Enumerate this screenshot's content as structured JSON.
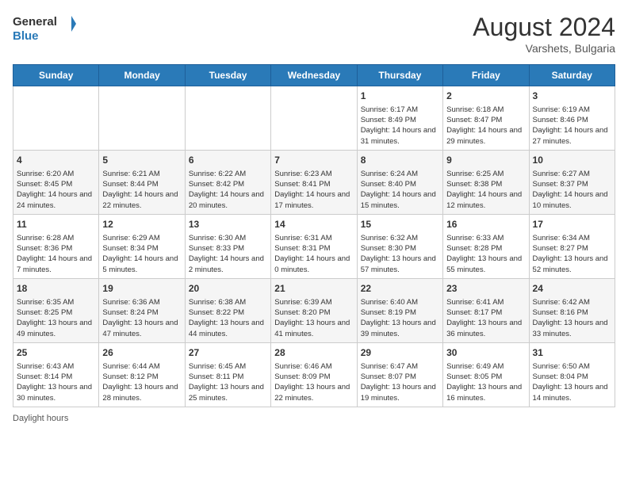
{
  "header": {
    "logo_general": "General",
    "logo_blue": "Blue",
    "month_year": "August 2024",
    "location": "Varshets, Bulgaria"
  },
  "days_of_week": [
    "Sunday",
    "Monday",
    "Tuesday",
    "Wednesday",
    "Thursday",
    "Friday",
    "Saturday"
  ],
  "weeks": [
    [
      {
        "day": "",
        "content": ""
      },
      {
        "day": "",
        "content": ""
      },
      {
        "day": "",
        "content": ""
      },
      {
        "day": "",
        "content": ""
      },
      {
        "day": "1",
        "content": "Sunrise: 6:17 AM\nSunset: 8:49 PM\nDaylight: 14 hours and 31 minutes."
      },
      {
        "day": "2",
        "content": "Sunrise: 6:18 AM\nSunset: 8:47 PM\nDaylight: 14 hours and 29 minutes."
      },
      {
        "day": "3",
        "content": "Sunrise: 6:19 AM\nSunset: 8:46 PM\nDaylight: 14 hours and 27 minutes."
      }
    ],
    [
      {
        "day": "4",
        "content": "Sunrise: 6:20 AM\nSunset: 8:45 PM\nDaylight: 14 hours and 24 minutes."
      },
      {
        "day": "5",
        "content": "Sunrise: 6:21 AM\nSunset: 8:44 PM\nDaylight: 14 hours and 22 minutes."
      },
      {
        "day": "6",
        "content": "Sunrise: 6:22 AM\nSunset: 8:42 PM\nDaylight: 14 hours and 20 minutes."
      },
      {
        "day": "7",
        "content": "Sunrise: 6:23 AM\nSunset: 8:41 PM\nDaylight: 14 hours and 17 minutes."
      },
      {
        "day": "8",
        "content": "Sunrise: 6:24 AM\nSunset: 8:40 PM\nDaylight: 14 hours and 15 minutes."
      },
      {
        "day": "9",
        "content": "Sunrise: 6:25 AM\nSunset: 8:38 PM\nDaylight: 14 hours and 12 minutes."
      },
      {
        "day": "10",
        "content": "Sunrise: 6:27 AM\nSunset: 8:37 PM\nDaylight: 14 hours and 10 minutes."
      }
    ],
    [
      {
        "day": "11",
        "content": "Sunrise: 6:28 AM\nSunset: 8:36 PM\nDaylight: 14 hours and 7 minutes."
      },
      {
        "day": "12",
        "content": "Sunrise: 6:29 AM\nSunset: 8:34 PM\nDaylight: 14 hours and 5 minutes."
      },
      {
        "day": "13",
        "content": "Sunrise: 6:30 AM\nSunset: 8:33 PM\nDaylight: 14 hours and 2 minutes."
      },
      {
        "day": "14",
        "content": "Sunrise: 6:31 AM\nSunset: 8:31 PM\nDaylight: 14 hours and 0 minutes."
      },
      {
        "day": "15",
        "content": "Sunrise: 6:32 AM\nSunset: 8:30 PM\nDaylight: 13 hours and 57 minutes."
      },
      {
        "day": "16",
        "content": "Sunrise: 6:33 AM\nSunset: 8:28 PM\nDaylight: 13 hours and 55 minutes."
      },
      {
        "day": "17",
        "content": "Sunrise: 6:34 AM\nSunset: 8:27 PM\nDaylight: 13 hours and 52 minutes."
      }
    ],
    [
      {
        "day": "18",
        "content": "Sunrise: 6:35 AM\nSunset: 8:25 PM\nDaylight: 13 hours and 49 minutes."
      },
      {
        "day": "19",
        "content": "Sunrise: 6:36 AM\nSunset: 8:24 PM\nDaylight: 13 hours and 47 minutes."
      },
      {
        "day": "20",
        "content": "Sunrise: 6:38 AM\nSunset: 8:22 PM\nDaylight: 13 hours and 44 minutes."
      },
      {
        "day": "21",
        "content": "Sunrise: 6:39 AM\nSunset: 8:20 PM\nDaylight: 13 hours and 41 minutes."
      },
      {
        "day": "22",
        "content": "Sunrise: 6:40 AM\nSunset: 8:19 PM\nDaylight: 13 hours and 39 minutes."
      },
      {
        "day": "23",
        "content": "Sunrise: 6:41 AM\nSunset: 8:17 PM\nDaylight: 13 hours and 36 minutes."
      },
      {
        "day": "24",
        "content": "Sunrise: 6:42 AM\nSunset: 8:16 PM\nDaylight: 13 hours and 33 minutes."
      }
    ],
    [
      {
        "day": "25",
        "content": "Sunrise: 6:43 AM\nSunset: 8:14 PM\nDaylight: 13 hours and 30 minutes."
      },
      {
        "day": "26",
        "content": "Sunrise: 6:44 AM\nSunset: 8:12 PM\nDaylight: 13 hours and 28 minutes."
      },
      {
        "day": "27",
        "content": "Sunrise: 6:45 AM\nSunset: 8:11 PM\nDaylight: 13 hours and 25 minutes."
      },
      {
        "day": "28",
        "content": "Sunrise: 6:46 AM\nSunset: 8:09 PM\nDaylight: 13 hours and 22 minutes."
      },
      {
        "day": "29",
        "content": "Sunrise: 6:47 AM\nSunset: 8:07 PM\nDaylight: 13 hours and 19 minutes."
      },
      {
        "day": "30",
        "content": "Sunrise: 6:49 AM\nSunset: 8:05 PM\nDaylight: 13 hours and 16 minutes."
      },
      {
        "day": "31",
        "content": "Sunrise: 6:50 AM\nSunset: 8:04 PM\nDaylight: 13 hours and 14 minutes."
      }
    ]
  ],
  "footer": {
    "note": "Daylight hours"
  }
}
